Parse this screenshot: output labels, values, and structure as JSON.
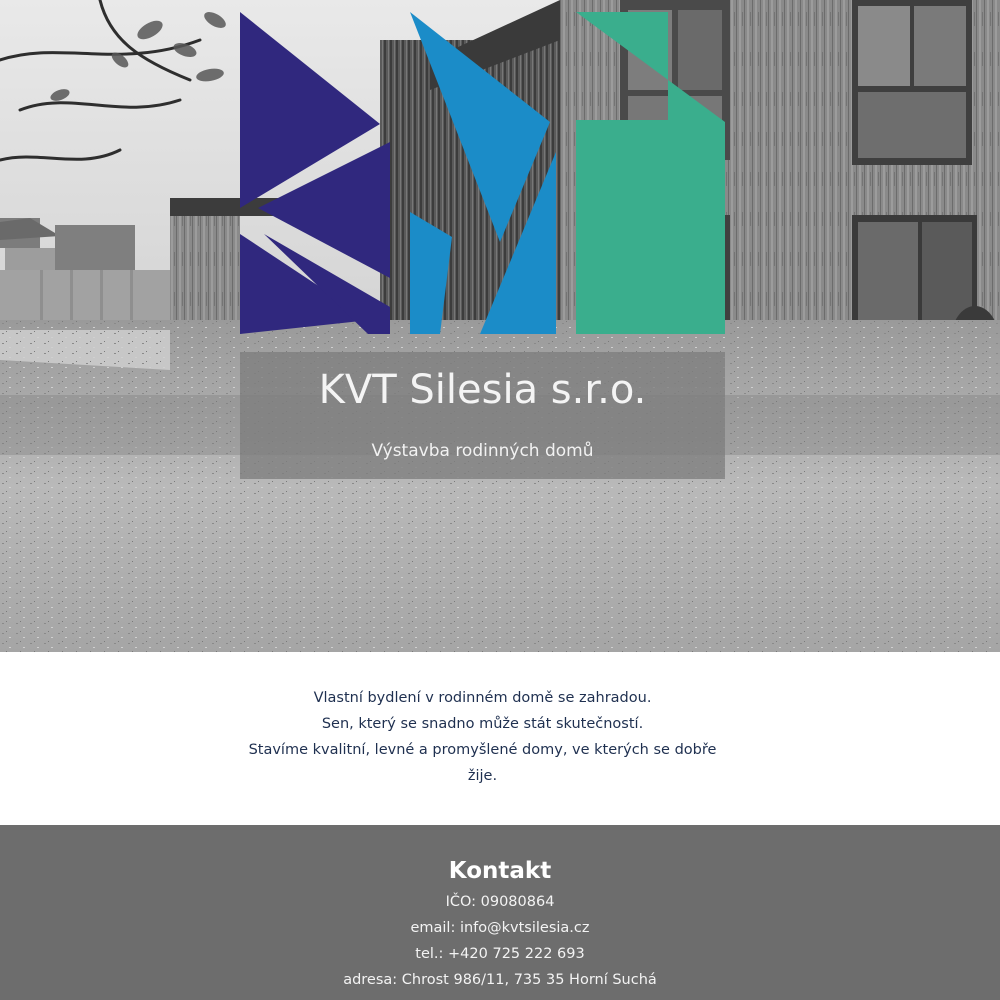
{
  "hero": {
    "company_name": "KVT Silesia s.r.o.",
    "tagline": "Výstavba rodinných domů",
    "logo": {
      "icon": "kvt-logo-icon",
      "colors": {
        "k": "#30287e",
        "v": "#1b8cc8",
        "t": "#3aae8d"
      }
    },
    "background": "house-photo-grayscale"
  },
  "intro": {
    "lines": [
      "Vlastní bydlení v rodinném domě se zahradou.",
      "Sen, který se snadno může stát skutečností.",
      "Stavíme kvalitní, levné a promyšlené domy, ve kterých se dobře",
      "žije."
    ]
  },
  "contact": {
    "heading": "Kontakt",
    "ico": "IČO: 09080864",
    "email_prefix": "email: ",
    "email": "info@kvtsilesia.cz",
    "phone_prefix": "tel.: ",
    "phone": "+420 725 222 693",
    "address": "adresa: Chrost 986/11, 735 35 Horní Suchá"
  },
  "colors": {
    "intro_text": "#1f3050",
    "contact_bg": "#6d6d6d"
  }
}
